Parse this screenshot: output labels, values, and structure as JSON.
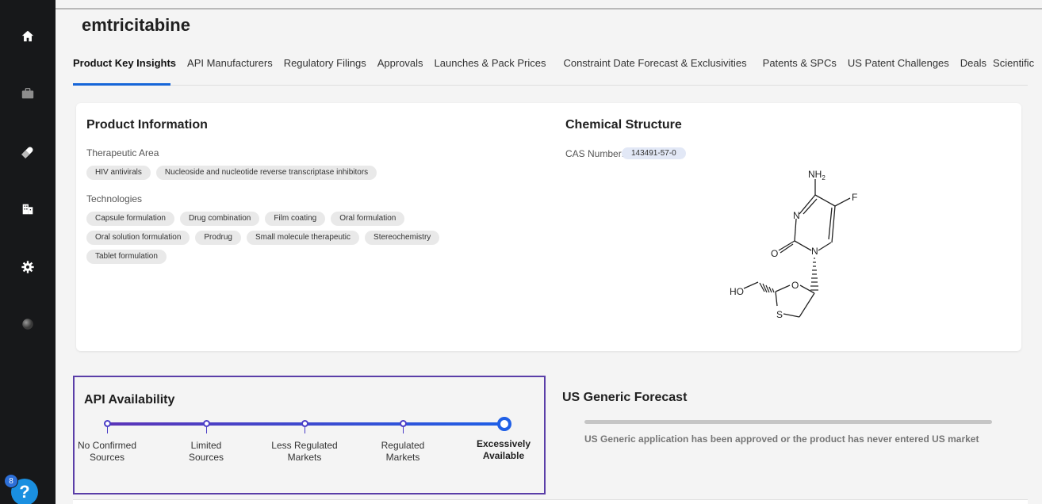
{
  "sidebar": {
    "icons": [
      "home-icon",
      "briefcase-icon",
      "pill-icon",
      "building-icon",
      "gear-icon",
      "globe-icon"
    ]
  },
  "page": {
    "title": "emtricitabine"
  },
  "tabs": [
    "Product Key Insights",
    "API Manufacturers",
    "Regulatory Filings",
    "Approvals",
    "Launches & Pack Prices",
    "Constraint Date Forecast & Exclusivities",
    "Patents & SPCs",
    "US Patent Challenges",
    "Deals",
    "Scientific"
  ],
  "product_info": {
    "title": "Product Information",
    "therapeutic_label": "Therapeutic Area",
    "therapeutic_chips": [
      "HIV antivirals",
      "Nucleoside and nucleotide reverse transcriptase inhibitors"
    ],
    "technologies_label": "Technologies",
    "technology_rows": [
      [
        "Capsule formulation",
        "Drug combination",
        "Film coating",
        "Oral formulation"
      ],
      [
        "Oral solution formulation",
        "Prodrug",
        "Small molecule therapeutic",
        "Stereochemistry"
      ],
      [
        "Tablet formulation"
      ]
    ]
  },
  "chemical": {
    "title": "Chemical Structure",
    "cas_label": "CAS Number:",
    "cas_value": "143491-57-0",
    "atoms": {
      "nh2": "NH",
      "nh2_sub": "2",
      "f": "F",
      "n1": "N",
      "n2": "N",
      "o_carbonyl": "O",
      "o_ring": "O",
      "s": "S",
      "ho": "HO"
    }
  },
  "api_availability": {
    "title": "API Availability",
    "steps": [
      [
        "No Confirmed",
        "Sources"
      ],
      [
        "Limited",
        "Sources"
      ],
      [
        "Less Regulated",
        "Markets"
      ],
      [
        "Regulated",
        "Markets"
      ],
      [
        "Excessively",
        "Available"
      ]
    ],
    "selected_index": 4
  },
  "us_generic_forecast": {
    "title": "US Generic Forecast",
    "message": "US Generic application has been approved or the product has never entered US market"
  },
  "help": {
    "badge": "8",
    "label": "?"
  }
}
